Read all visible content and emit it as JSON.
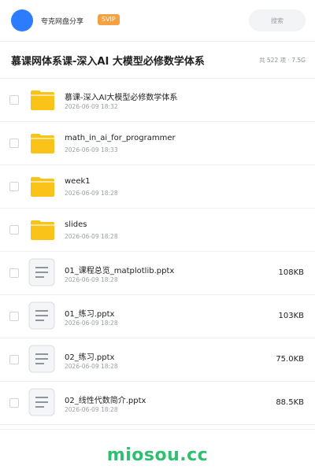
{
  "header": {
    "username": "夸克网盘分享",
    "badge": "SVIP",
    "search_label": "搜索"
  },
  "folder": {
    "title": "慕课网体系课-深入AI 大模型必修数学体系",
    "meta": "共 522 项 · 7.5G"
  },
  "items": [
    {
      "name": "慕课-深入AI大模型必修数学体系",
      "date": "2026-06-09 18:32",
      "size": "",
      "type": "folder-icon"
    },
    {
      "name": "math_in_ai_for_programmer",
      "date": "2026-06-09 18:33",
      "size": "",
      "type": "folder-icon"
    },
    {
      "name": "week1",
      "date": "2026-06-09 18:28",
      "size": "",
      "type": "folder-icon"
    },
    {
      "name": "slides",
      "date": "2026-06-09 18:28",
      "size": "",
      "type": "folder-icon"
    },
    {
      "name": "01_课程总览_matplotlib.pptx",
      "date": "2026-06-09 18:28",
      "size": "108KB",
      "type": "document-icon"
    },
    {
      "name": "01_练习.pptx",
      "date": "2026-06-09 18:28",
      "size": "103KB",
      "type": "document-icon"
    },
    {
      "name": "02_练习.pptx",
      "date": "2026-06-09 18:28",
      "size": "75.0KB",
      "type": "document-icon"
    },
    {
      "name": "02_线性代数简介.pptx",
      "date": "2026-06-09 18:28",
      "size": "88.5KB",
      "type": "document-icon"
    }
  ],
  "footer": {
    "watermark": "miosou.cc"
  },
  "colors": {
    "accent": "#2b7cff",
    "folder": "#f9c31a",
    "badge": "#f5a142",
    "watermark": "#2fbf71"
  }
}
